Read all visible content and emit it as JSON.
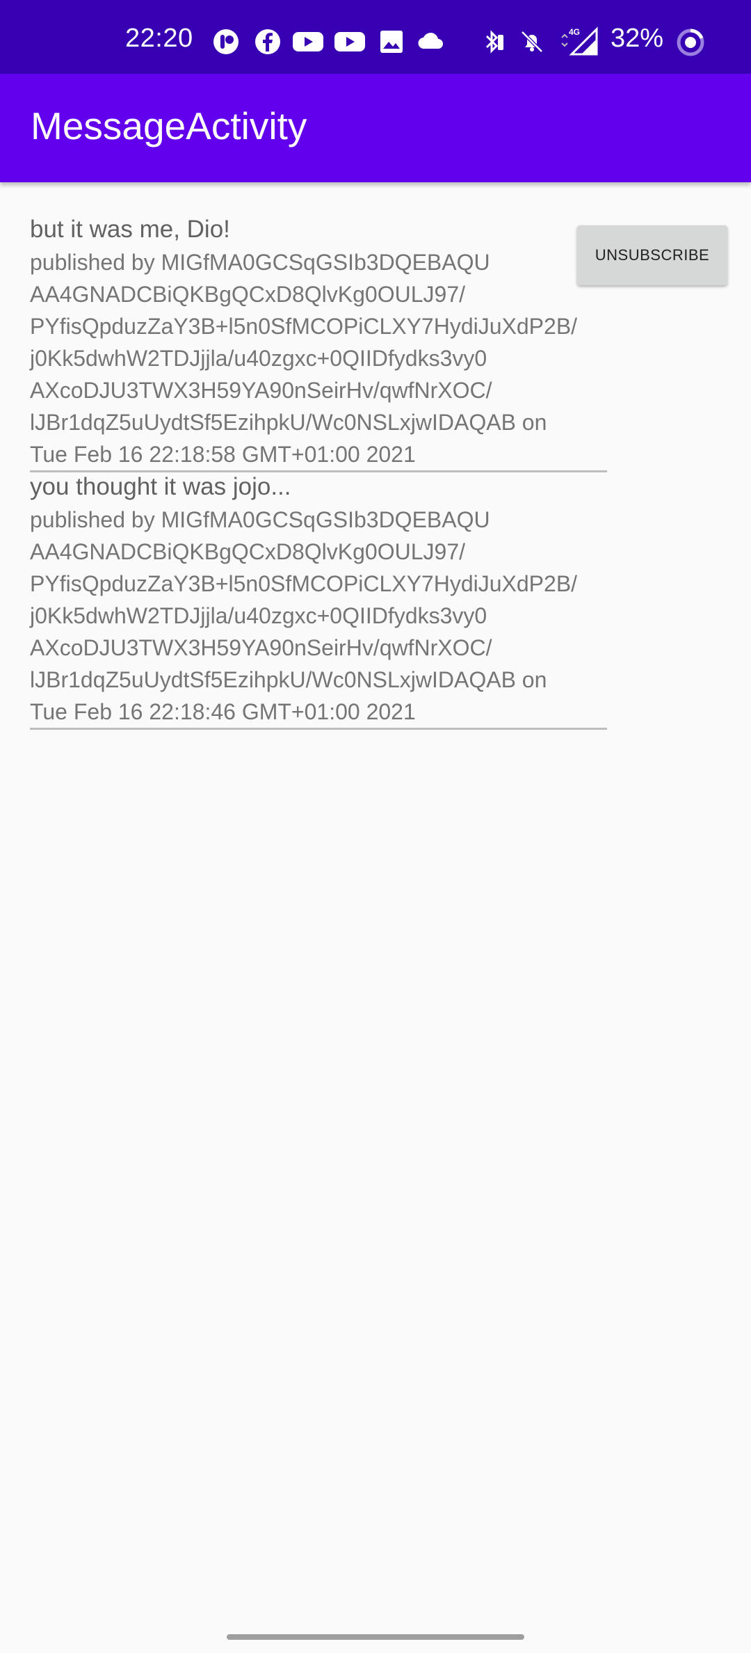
{
  "status_bar": {
    "time": "22:20",
    "battery": "32%",
    "network": "4G",
    "background_color": "#3700B3",
    "icons": [
      "app-icon",
      "facebook-icon",
      "youtube-icon",
      "youtube-icon",
      "gallery-icon",
      "cloud-icon",
      "bluetooth-icon",
      "mute-icon",
      "signal-icon",
      "battery-icon"
    ]
  },
  "app_bar": {
    "title": "MessageActivity",
    "background_color": "#6200EE"
  },
  "unsubscribe_button": {
    "label": "UNSUBSCRIBE"
  },
  "messages": [
    {
      "title": "but it was me, Dio!",
      "meta": "published by MIGfMA0GCSqGSIb3DQEBAQU\nAA4GNADCBiQKBgQCxD8QlvKg0OULJ97/\nPYfisQpduzZaY3B+l5n0SfMCOPiCLXY7HydiJuXdP2B/\nj0Kk5dwhW2TDJjjla/u40zgxc+0QIIDfydks3vy0\nAXcoDJU3TWX3H59YA90nSeirHv/qwfNrXOC/\nlJBr1dqZ5uUydtSf5EzihpkU/Wc0NSLxjwIDAQAB on\nTue Feb 16 22:18:58 GMT+01:00 2021"
    },
    {
      "title": "you thought it was jojo...",
      "meta": "published by MIGfMA0GCSqGSIb3DQEBAQU\nAA4GNADCBiQKBgQCxD8QlvKg0OULJ97/\nPYfisQpduzZaY3B+l5n0SfMCOPiCLXY7HydiJuXdP2B/\nj0Kk5dwhW2TDJjjla/u40zgxc+0QIIDfydks3vy0\nAXcoDJU3TWX3H59YA90nSeirHv/qwfNrXOC/\nlJBr1dqZ5uUydtSf5EzihpkU/Wc0NSLxjwIDAQAB on\nTue Feb 16 22:18:46 GMT+01:00 2021"
    }
  ]
}
